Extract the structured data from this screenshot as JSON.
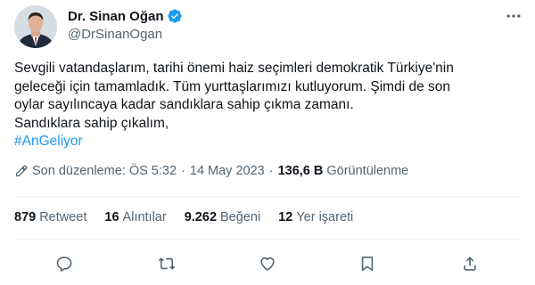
{
  "author": {
    "display_name": "Dr. Sinan Oğan",
    "handle": "@DrSinanOgan",
    "verified_color": "#1d9bf0"
  },
  "tweet": {
    "lines": [
      "Sevgili vatandaşlarım, tarihi önemi haiz seçimleri demokratik Türkiye'nin",
      "geleceği için tamamladık. Tüm yurttaşlarımızı kutluyorum. Şimdi de son",
      "oylar sayılıncaya kadar sandıklara sahip çıkma zamanı.",
      "Sandıklara sahip çıkalım,"
    ],
    "hashtag": "#AnGeliyor",
    "hashtag_color": "#1d9bf0"
  },
  "meta": {
    "edited_label": "Son düzenleme: ÖS 5:32",
    "separator": "·",
    "date": "14 May 2023",
    "views_count": "136,6 B",
    "views_label": "Görüntülenme"
  },
  "stats": [
    {
      "count": "879",
      "label": "Retweet"
    },
    {
      "count": "16",
      "label": "Alıntılar"
    },
    {
      "count": "9.262",
      "label": "Beğeni"
    },
    {
      "count": "12",
      "label": "Yer işareti"
    }
  ],
  "icons": {
    "more": "more-icon",
    "edit": "pencil-icon",
    "reply": "reply-icon",
    "retweet": "retweet-icon",
    "like": "heart-icon",
    "share": "share-icon"
  },
  "colors": {
    "text": "#0f1419",
    "secondary": "#536471",
    "accent": "#1d9bf0",
    "divider": "#eff3f4"
  }
}
